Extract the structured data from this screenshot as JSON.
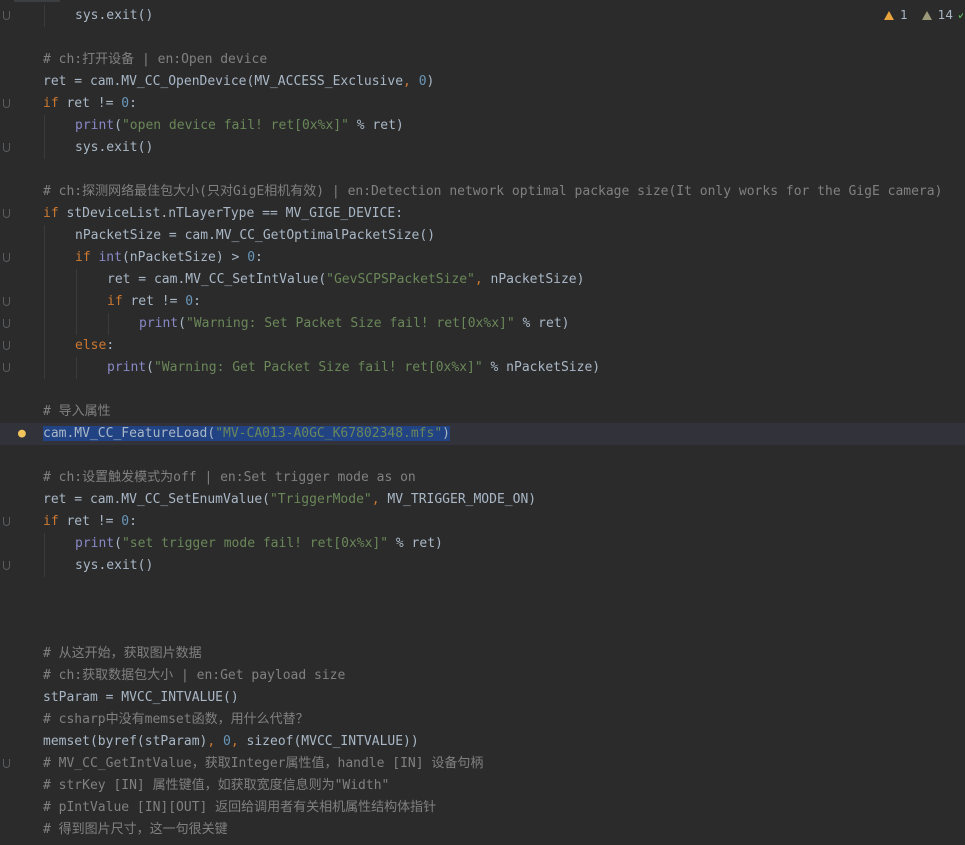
{
  "status": {
    "warnings_count": "1",
    "weak_warnings_count": "14",
    "check_mark": "✓"
  },
  "code_lines": [
    {
      "indent": 1,
      "fold": true,
      "tokens": [
        {
          "t": "sys.exit()",
          "c": "df"
        }
      ]
    },
    {
      "indent": 0,
      "fold": false,
      "tokens": []
    },
    {
      "indent": 0,
      "fold": false,
      "tokens": [
        {
          "t": "# ch:打开设备 | en:Open device",
          "c": "cm"
        }
      ]
    },
    {
      "indent": 0,
      "fold": false,
      "tokens": [
        {
          "t": "ret = cam.MV_CC_OpenDevice(MV_ACCESS_Exclusive",
          "c": "df"
        },
        {
          "t": ", ",
          "c": "kw"
        },
        {
          "t": "0",
          "c": "num"
        },
        {
          "t": ")",
          "c": "df"
        }
      ]
    },
    {
      "indent": 0,
      "fold": true,
      "tokens": [
        {
          "t": "if ",
          "c": "kw"
        },
        {
          "t": "ret != ",
          "c": "df"
        },
        {
          "t": "0",
          "c": "num"
        },
        {
          "t": ":",
          "c": "df"
        }
      ]
    },
    {
      "indent": 1,
      "fold": false,
      "tokens": [
        {
          "t": "print",
          "c": "bi"
        },
        {
          "t": "(",
          "c": "df"
        },
        {
          "t": "\"open device fail! ret[0x%x]\"",
          "c": "str"
        },
        {
          "t": " % ret)",
          "c": "df"
        }
      ]
    },
    {
      "indent": 1,
      "fold": true,
      "tokens": [
        {
          "t": "sys.exit()",
          "c": "df"
        }
      ]
    },
    {
      "indent": 0,
      "fold": false,
      "tokens": []
    },
    {
      "indent": 0,
      "fold": false,
      "tokens": [
        {
          "t": "# ch:探测网络最佳包大小(只对GigE相机有效) | en:Detection network optimal package size(It only works for the GigE camera)",
          "c": "cm"
        }
      ]
    },
    {
      "indent": 0,
      "fold": true,
      "tokens": [
        {
          "t": "if ",
          "c": "kw"
        },
        {
          "t": "stDeviceList.nTLayerType == MV_GIGE_DEVICE:",
          "c": "df"
        }
      ]
    },
    {
      "indent": 1,
      "fold": false,
      "tokens": [
        {
          "t": "nPacketSize = cam.MV_CC_GetOptimalPacketSize()",
          "c": "df"
        }
      ]
    },
    {
      "indent": 1,
      "fold": true,
      "tokens": [
        {
          "t": "if ",
          "c": "kw"
        },
        {
          "t": "int",
          "c": "bi"
        },
        {
          "t": "(nPacketSize) > ",
          "c": "df"
        },
        {
          "t": "0",
          "c": "num"
        },
        {
          "t": ":",
          "c": "df"
        }
      ]
    },
    {
      "indent": 2,
      "fold": false,
      "tokens": [
        {
          "t": "ret = cam.MV_CC_SetIntValue(",
          "c": "df"
        },
        {
          "t": "\"GevSCPSPacketSize\"",
          "c": "str"
        },
        {
          "t": ", ",
          "c": "kw"
        },
        {
          "t": "nPacketSize)",
          "c": "df"
        }
      ]
    },
    {
      "indent": 2,
      "fold": true,
      "tokens": [
        {
          "t": "if ",
          "c": "kw"
        },
        {
          "t": "ret != ",
          "c": "df"
        },
        {
          "t": "0",
          "c": "num"
        },
        {
          "t": ":",
          "c": "df"
        }
      ]
    },
    {
      "indent": 3,
      "fold": true,
      "tokens": [
        {
          "t": "print",
          "c": "bi"
        },
        {
          "t": "(",
          "c": "df"
        },
        {
          "t": "\"Warning: Set Packet Size fail! ret[0x%x]\"",
          "c": "str"
        },
        {
          "t": " % ret)",
          "c": "df"
        }
      ]
    },
    {
      "indent": 1,
      "fold": true,
      "tokens": [
        {
          "t": "else",
          "c": "kw"
        },
        {
          "t": ":",
          "c": "df"
        }
      ]
    },
    {
      "indent": 2,
      "fold": true,
      "tokens": [
        {
          "t": "print",
          "c": "bi"
        },
        {
          "t": "(",
          "c": "df"
        },
        {
          "t": "\"Warning: Get Packet Size fail! ret[0x%x]\"",
          "c": "str"
        },
        {
          "t": " % nPacketSize)",
          "c": "df"
        }
      ]
    },
    {
      "indent": 0,
      "fold": false,
      "tokens": []
    },
    {
      "indent": 0,
      "fold": false,
      "tokens": [
        {
          "t": "# 导入属性",
          "c": "cm"
        }
      ]
    },
    {
      "indent": 0,
      "fold": false,
      "hl": true,
      "bulb": true,
      "tokens": [
        {
          "t": "cam.MV_CC_FeatureLoad(",
          "c": "df",
          "sel": true
        },
        {
          "t": "\"MV-CA013-A0GC_K67802348.mfs\"",
          "c": "str",
          "sel": true
        },
        {
          "t": ")",
          "c": "df",
          "sel": true
        }
      ]
    },
    {
      "indent": 0,
      "fold": false,
      "tokens": []
    },
    {
      "indent": 0,
      "fold": false,
      "tokens": [
        {
          "t": "# ch:设置触发模式为off | en:Set trigger mode as on",
          "c": "cm"
        }
      ]
    },
    {
      "indent": 0,
      "fold": false,
      "tokens": [
        {
          "t": "ret = cam.MV_CC_SetEnumValue(",
          "c": "df"
        },
        {
          "t": "\"TriggerMode\"",
          "c": "str"
        },
        {
          "t": ", ",
          "c": "kw"
        },
        {
          "t": "MV_TRIGGER_MODE_ON)",
          "c": "df"
        }
      ]
    },
    {
      "indent": 0,
      "fold": true,
      "tokens": [
        {
          "t": "if ",
          "c": "kw"
        },
        {
          "t": "ret != ",
          "c": "df"
        },
        {
          "t": "0",
          "c": "num"
        },
        {
          "t": ":",
          "c": "df"
        }
      ]
    },
    {
      "indent": 1,
      "fold": false,
      "tokens": [
        {
          "t": "print",
          "c": "bi"
        },
        {
          "t": "(",
          "c": "df"
        },
        {
          "t": "\"set trigger mode fail! ret[0x%x]\"",
          "c": "str"
        },
        {
          "t": " % ret)",
          "c": "df"
        }
      ]
    },
    {
      "indent": 1,
      "fold": true,
      "tokens": [
        {
          "t": "sys.exit()",
          "c": "df"
        }
      ]
    },
    {
      "indent": 0,
      "fold": false,
      "tokens": []
    },
    {
      "indent": 0,
      "fold": false,
      "tokens": []
    },
    {
      "indent": 0,
      "fold": false,
      "tokens": []
    },
    {
      "indent": 0,
      "fold": false,
      "tokens": [
        {
          "t": "# 从这开始，获取图片数据",
          "c": "cm"
        }
      ]
    },
    {
      "indent": 0,
      "fold": false,
      "tokens": [
        {
          "t": "# ch:获取数据包大小 | en:Get payload size",
          "c": "cm"
        }
      ]
    },
    {
      "indent": 0,
      "fold": false,
      "tokens": [
        {
          "t": "stParam = MVCC_INTVALUE()",
          "c": "df"
        }
      ]
    },
    {
      "indent": 0,
      "fold": false,
      "tokens": [
        {
          "t": "# csharp中没有memset函数，用什么代替？",
          "c": "cm"
        }
      ]
    },
    {
      "indent": 0,
      "fold": false,
      "tokens": [
        {
          "t": "memset(byref(stParam)",
          "c": "df"
        },
        {
          "t": ", ",
          "c": "kw"
        },
        {
          "t": "0",
          "c": "num"
        },
        {
          "t": ", ",
          "c": "kw"
        },
        {
          "t": "sizeof(MVCC_INTVALUE))",
          "c": "df"
        }
      ]
    },
    {
      "indent": 0,
      "fold": true,
      "tokens": [
        {
          "t": "# MV_CC_GetIntValue，获取Integer属性值，handle [IN] 设备句柄",
          "c": "cm"
        }
      ]
    },
    {
      "indent": 0,
      "fold": false,
      "tokens": [
        {
          "t": "# strKey [IN] 属性键值，如获取宽度信息则为\"Width\"",
          "c": "cm"
        }
      ]
    },
    {
      "indent": 0,
      "fold": false,
      "tokens": [
        {
          "t": "# pIntValue [IN][OUT] 返回给调用者有关相机属性结构体指针",
          "c": "cm"
        }
      ]
    },
    {
      "indent": 0,
      "fold": false,
      "tokens": [
        {
          "t": "# 得到图片尺寸，这一句很关键",
          "c": "cm"
        }
      ]
    }
  ]
}
